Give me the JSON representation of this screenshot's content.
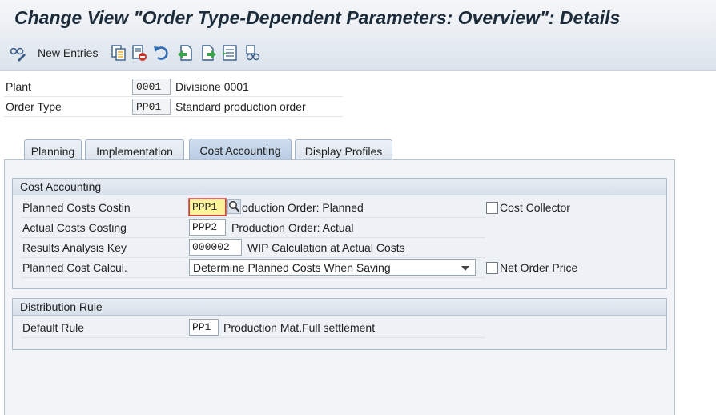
{
  "title": "Change View \"Order Type-Dependent Parameters: Overview\": Details",
  "toolbar": {
    "new_entries": "New Entries",
    "icons": [
      "glasses-pencil-icon",
      "copy-icon",
      "delete-icon",
      "undo-icon",
      "previous-entry-icon",
      "next-entry-icon",
      "select-block-icon",
      "glasses-icon"
    ]
  },
  "header": {
    "plant": {
      "label": "Plant",
      "code": "0001",
      "desc": "Divisione 0001"
    },
    "order_type": {
      "label": "Order Type",
      "code": "PP01",
      "desc": "Standard production order"
    }
  },
  "tabs": [
    {
      "label": "Planning"
    },
    {
      "label": "Implementation"
    },
    {
      "label": "Cost Accounting",
      "active": true
    },
    {
      "label": "Display Profiles"
    }
  ],
  "cost_accounting": {
    "group_title": "Cost Accounting",
    "planned_costs": {
      "label": "Planned Costs Costin",
      "value": "PPP1",
      "desc": "oduction Order: Planned"
    },
    "actual_costs": {
      "label": "Actual Costs Costing",
      "value": "PPP2",
      "desc": "Production Order: Actual"
    },
    "results_analysis": {
      "label": "Results Analysis Key",
      "value": "000002",
      "desc": "WIP Calculation at Actual Costs"
    },
    "planned_cost_calc": {
      "label": "Planned Cost Calcul.",
      "value": "Determine Planned Costs When Saving"
    },
    "cost_collector": {
      "label": "Cost Collector",
      "checked": false
    },
    "net_order_price": {
      "label": "Net Order Price",
      "checked": false
    }
  },
  "distribution_rule": {
    "group_title": "Distribution Rule",
    "default_rule": {
      "label": "Default Rule",
      "value": "PP1",
      "desc": "Production Mat.Full settlement"
    }
  },
  "colors": {
    "focus_field": "#fdf39a",
    "focus_border": "#d04040",
    "tab_active": "#c5d5e8"
  }
}
